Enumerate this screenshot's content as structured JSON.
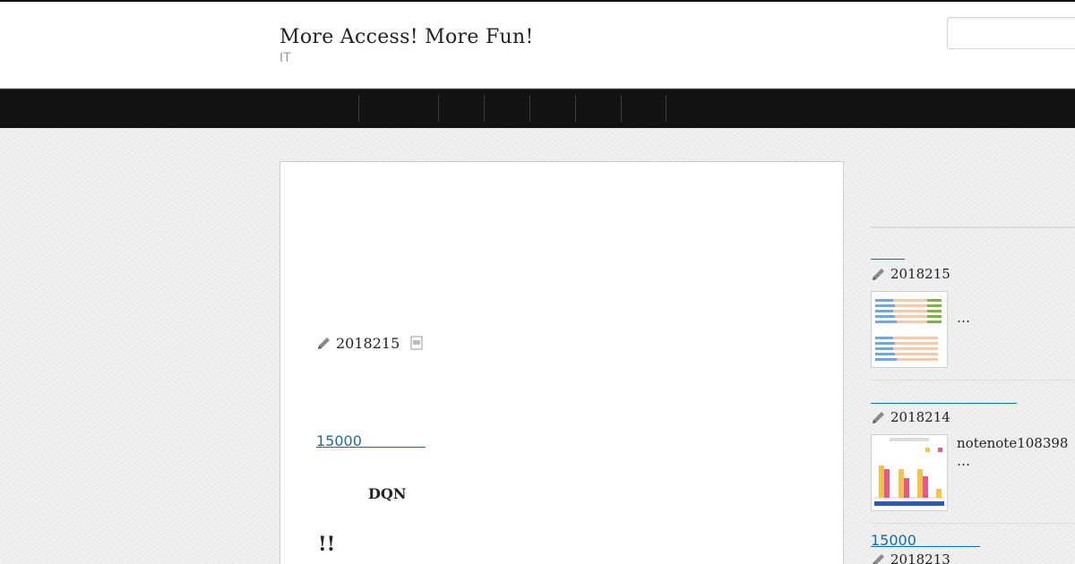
{
  "header": {
    "site_title": "More Access! More Fun!",
    "site_description": "IT",
    "search_placeholder": ""
  },
  "nav": {
    "items": [
      "",
      "",
      "",
      "",
      "",
      ""
    ]
  },
  "article": {
    "date": "2018215",
    "link_text": "15000              ",
    "bold_text": "DQN",
    "exclaim_text": "!!"
  },
  "sidebar": {
    "entries": [
      {
        "date": "2018215",
        "excerpt": "…"
      },
      {
        "date": "2018214",
        "excerpt_line1": "notenote108398",
        "excerpt_line2": "…"
      },
      {
        "link_text": "15000              ",
        "date": "2018213"
      }
    ]
  },
  "colors": {
    "link": "#1a6aa8",
    "nav_bg": "#131313",
    "header_border": "#111111"
  }
}
